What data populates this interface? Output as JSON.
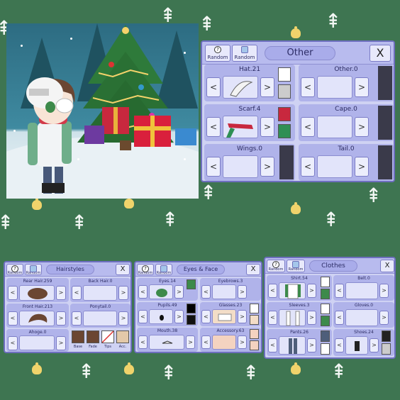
{
  "other_panel": {
    "random_label": "Random",
    "title": "Other",
    "close": "X",
    "slots": [
      {
        "label": "Hat.21"
      },
      {
        "label": "Other.0"
      },
      {
        "label": "Scarf.4"
      },
      {
        "label": "Cape.0"
      },
      {
        "label": "Wings.0"
      },
      {
        "label": "Tail.0"
      }
    ],
    "swatches": {
      "hat": [
        "#ffffff",
        "#cccccc"
      ],
      "scarf": [
        "#c8283e",
        "#2f8f54"
      ]
    }
  },
  "hair_panel": {
    "random_label": "Random",
    "title": "Hairstyles",
    "close": "X",
    "slots": [
      {
        "label": "Rear Hair.259"
      },
      {
        "label": "Back Hair.0"
      },
      {
        "label": "Front Hair.213"
      },
      {
        "label": "Ponytail.0"
      },
      {
        "label": "Ahoge.0"
      }
    ],
    "color_labels": [
      "Base",
      "Fade",
      "Tips",
      "Acc."
    ],
    "colors": [
      "#6b4632",
      "#6b4632",
      "#ffffff",
      "#e3c9a9"
    ]
  },
  "face_panel": {
    "random_label": "Random",
    "title": "Eyes & Face",
    "close": "X",
    "slots": [
      {
        "label": "Eyes.14"
      },
      {
        "label": "Eyebrows.3"
      },
      {
        "label": "Pupils.49"
      },
      {
        "label": "Glasses.23"
      },
      {
        "label": "Mouth.38"
      },
      {
        "label": "Accessory.63"
      }
    ],
    "swatches": {
      "eyes": [
        "#3d8a4b"
      ],
      "pupils": [
        "#000000",
        "#111111"
      ],
      "glasses": [
        "#ffffff",
        "#f3ddc7"
      ],
      "accessory": [
        "#f4d3c0",
        "#f4d3c0"
      ]
    }
  },
  "clothes_panel": {
    "random_label": "Random",
    "title": "Clothes",
    "close": "X",
    "slots": [
      {
        "label": "Shirt.54"
      },
      {
        "label": "Belt.0"
      },
      {
        "label": "Sleeves.3"
      },
      {
        "label": "Gloves.0"
      },
      {
        "label": "Pants.26"
      },
      {
        "label": "Shoes.24"
      }
    ],
    "swatches": {
      "shirt": [
        "#ffffff",
        "#3d8a4b"
      ],
      "sleeves": [
        "#ffffff",
        "#3d8a4b"
      ],
      "pants": [
        "#4e5e7a",
        "#ffffff"
      ],
      "shoes": [
        "#222222",
        "#cccccc"
      ]
    }
  },
  "arrows": {
    "left": "<",
    "right": ">"
  },
  "colors": {
    "background": "#3e7551",
    "panel": "#cfd2f3",
    "panel_border": "#6e6fbf"
  }
}
